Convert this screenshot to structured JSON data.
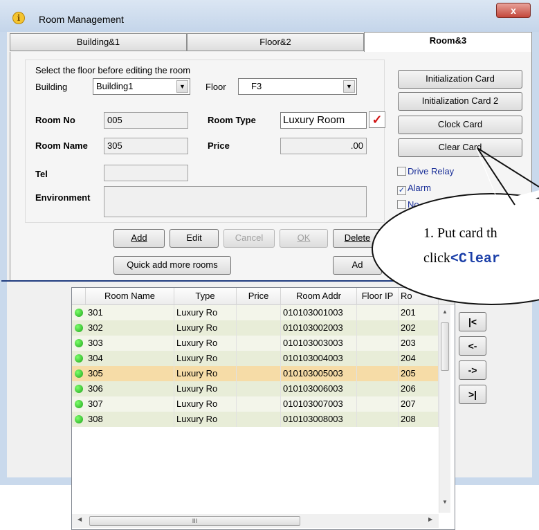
{
  "window": {
    "title": "Room Management",
    "close_label": "x",
    "icon_label": "i"
  },
  "tabs": [
    {
      "label": "Building&1"
    },
    {
      "label": "Floor&2"
    },
    {
      "label": "Room&3"
    }
  ],
  "form": {
    "hint": "Select the floor before editing the room",
    "building_label": "Building",
    "building_value": "Building1",
    "floor_label": "Floor",
    "floor_value": "F3",
    "room_no_label": "Room No",
    "room_no_value": "005",
    "room_type_label": "Room Type",
    "room_type_value": "Luxury Room",
    "room_name_label": "Room Name",
    "room_name_value": "305",
    "price_label": "Price",
    "price_value": ".00",
    "tel_label": "Tel",
    "tel_value": "",
    "environment_label": "Environment",
    "environment_value": ""
  },
  "side_buttons": [
    "Initialization Card",
    "Initialization Card 2",
    "Clock Card",
    "Clear Card"
  ],
  "checkboxes": [
    {
      "label": "Drive Relay",
      "checked": false
    },
    {
      "label": "Alarm",
      "checked": true
    },
    {
      "label": "No",
      "checked": false
    }
  ],
  "actions": {
    "add": "Add",
    "edit": "Edit",
    "cancel": "Cancel",
    "ok": "OK",
    "delete": "Delete",
    "quick_add": "Quick add more rooms",
    "ad": "Ad"
  },
  "grid": {
    "columns": [
      "Room Name",
      "Type",
      "Price",
      "Room Addr",
      "Floor IP",
      "Ro"
    ],
    "rows": [
      {
        "name": "301",
        "type": "Luxury Ro",
        "price": "",
        "addr": "010103001003",
        "ro": "201",
        "selected": false
      },
      {
        "name": "302",
        "type": "Luxury Ro",
        "price": "",
        "addr": "010103002003",
        "ro": "202",
        "selected": false
      },
      {
        "name": "303",
        "type": "Luxury Ro",
        "price": "",
        "addr": "010103003003",
        "ro": "203",
        "selected": false
      },
      {
        "name": "304",
        "type": "Luxury Ro",
        "price": "",
        "addr": "010103004003",
        "ro": "204",
        "selected": false
      },
      {
        "name": "305",
        "type": "Luxury Ro",
        "price": "",
        "addr": "010103005003",
        "ro": "205",
        "selected": true
      },
      {
        "name": "306",
        "type": "Luxury Ro",
        "price": "",
        "addr": "010103006003",
        "ro": "206",
        "selected": false
      },
      {
        "name": "307",
        "type": "Luxury Ro",
        "price": "",
        "addr": "010103007003",
        "ro": "207",
        "selected": false
      },
      {
        "name": "308",
        "type": "Luxury Ro",
        "price": "",
        "addr": "010103008003",
        "ro": "208",
        "selected": false
      }
    ],
    "scroll_thumb_label": "III"
  },
  "nav_buttons": [
    "|<",
    "<-",
    "->",
    ">|"
  ],
  "callout": {
    "line1": "1. Put card th",
    "line2_prefix": "click",
    "line2_code": "<Clear"
  },
  "colors": {
    "row_even": "#e8edd8",
    "row_odd": "#f3f5ea",
    "row_selected": "#f6dca7",
    "divider": "#1f3c7f"
  }
}
